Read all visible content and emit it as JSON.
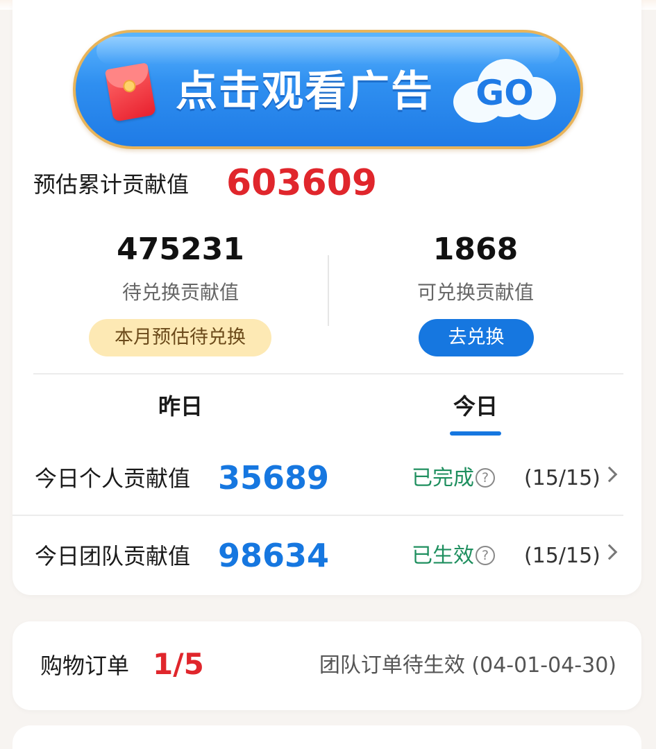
{
  "ad_banner": {
    "text": "点击观看广告",
    "go_label": "GO",
    "colors": {
      "border": "#e8b45a",
      "fill": "#2f8ff0",
      "text": "#ffffff"
    }
  },
  "summary": {
    "total_label": "预估累计贡献值",
    "total_value": "603609",
    "pending": {
      "value": "475231",
      "label": "待兑换贡献值",
      "pill": "本月预估待兑换"
    },
    "redeemable": {
      "value": "1868",
      "label": "可兑换贡献值",
      "button": "去兑换"
    }
  },
  "tabs": [
    {
      "label": "昨日",
      "active": false
    },
    {
      "label": "今日",
      "active": true
    }
  ],
  "rows": [
    {
      "label": "今日个人贡献值",
      "value": "35689",
      "status": "已完成",
      "count": "(15/15)"
    },
    {
      "label": "今日团队贡献值",
      "value": "98634",
      "status": "已生效",
      "count": "(15/15)"
    }
  ],
  "orders": {
    "label": "购物订单",
    "value": "1/5",
    "status": "团队订单待生效 (04-01-04-30)"
  },
  "colors": {
    "accent_blue": "#1677e0",
    "highlight_red": "#e0262c",
    "status_green": "#1f8f5f",
    "pill_yellow": "#fde9b4"
  }
}
